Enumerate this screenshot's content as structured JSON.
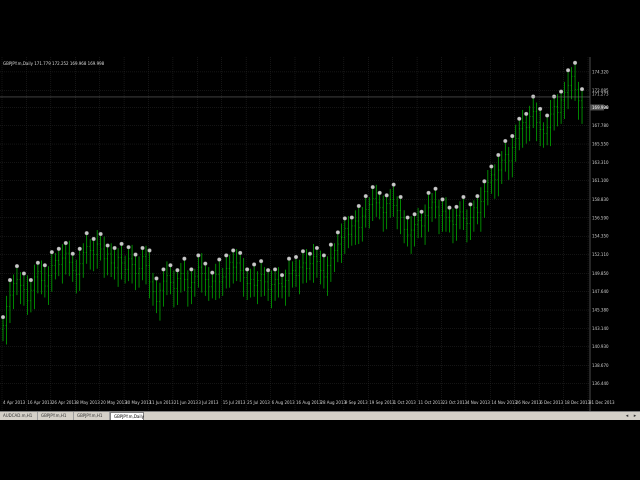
{
  "window": {
    "title": "GBPJPY.m,Daily 171.779 172.252 169.968 169.998",
    "background": "#000000",
    "grid_color": "#2a2a2a",
    "up_bar_color": "#00c000",
    "down_bar_color": "#00c000",
    "marker_color": "#c8c8c8",
    "label_color": "#d0d0d0",
    "price_line_color": "#808080"
  },
  "tabs": [
    {
      "label": "AUDCAD.m,H1",
      "active": false
    },
    {
      "label": "GBPJPY.m,H1",
      "active": false
    },
    {
      "label": "GBPJPY.m,H1",
      "active": false
    },
    {
      "label": "GBPJPY.m,Daily",
      "active": true
    }
  ],
  "tab_nav": {
    "left_icon": "arrow-left-icon",
    "right_icon": "arrow-right-icon"
  },
  "chart_data": {
    "type": "bar",
    "symbol": "GBPJPY.m",
    "timeframe": "Daily",
    "ohlc_header": {
      "open": 171.779,
      "high": 172.252,
      "low": 169.968,
      "close": 169.998
    },
    "current_price_label": "169.998",
    "prev_price_label": "171.273",
    "y_axis_ticks": [
      "174.320",
      "172.085",
      "170.020",
      "167.780",
      "165.550",
      "163.310",
      "161.100",
      "158.830",
      "156.590",
      "154.350",
      "152.110",
      "149.850",
      "147.640",
      "145.380",
      "143.140",
      "140.930",
      "138.670",
      "136.440"
    ],
    "x_axis_ticks": [
      "4 Apr 2013",
      "16 Apr 2013",
      "26 Apr 2013",
      "8 May 2013",
      "20 May 2013",
      "30 May 2013",
      "11 Jun 2013",
      "21 Jun 2013",
      "3 Jul 2013",
      "15 Jul 2013",
      "25 Jul 2013",
      "6 Aug 2013",
      "16 Aug 2013",
      "28 Aug 2013",
      "9 Sep 2013",
      "19 Sep 2013",
      "1 Oct 2013",
      "11 Oct 2013",
      "23 Oct 2013",
      "4 Nov 2013",
      "14 Nov 2013",
      "26 Nov 2013",
      "6 Dec 2013",
      "18 Dec 2013",
      "31 Dec 2013"
    ],
    "ylim": [
      133.6,
      175.4
    ],
    "closes": [
      143.5,
      145.8,
      147.2,
      148.6,
      149.1,
      148.4,
      147.9,
      146.5,
      147.8,
      149.4,
      150.1,
      149.0,
      148.3,
      149.6,
      150.8,
      151.4,
      150.9,
      151.7,
      152.3,
      151.2,
      150.2,
      149.7,
      151.0,
      152.4,
      153.1,
      152.6,
      152.1,
      153.4,
      152.8,
      151.6,
      152.2,
      151.1,
      150.5,
      151.8,
      151.1,
      150.3,
      151.6,
      150.9,
      149.8,
      150.4,
      151.9,
      150.8,
      148.8,
      147.6,
      146.4,
      147.8,
      148.9,
      149.6,
      148.7,
      148.0,
      149.2,
      149.8,
      149.1,
      148.1,
      148.7,
      149.5,
      150.6,
      149.8,
      149.1,
      148.2,
      148.9,
      149.7,
      148.8,
      149.4,
      150.4,
      151.2,
      150.6,
      151.1,
      150.2,
      149.3,
      148.6,
      149.1,
      148.4,
      149.0,
      149.7,
      148.8,
      147.9,
      148.5,
      149.1,
      148.6,
      148.2,
      149.0,
      149.8,
      150.2,
      149.6,
      150.6,
      151.1,
      150.4,
      151.0,
      151.9,
      151.3,
      150.2,
      149.4,
      150.8,
      151.7,
      152.6,
      153.4,
      154.2,
      155.3,
      154.6,
      155.6,
      156.2,
      155.4,
      156.8,
      157.6,
      158.2,
      158.9,
      158.4,
      157.8,
      157.2,
      158.3,
      158.8,
      158.1,
      157.5,
      156.6,
      155.2,
      154.5,
      155.1,
      155.8,
      156.3,
      155.6,
      156.9,
      157.8,
      158.5,
      157.9,
      156.9,
      157.4,
      156.6,
      156.2,
      155.8,
      156.9,
      157.3,
      156.5,
      155.9,
      156.6,
      157.8,
      157.2,
      158.6,
      159.8,
      160.9,
      161.8,
      161.2,
      162.4,
      163.6,
      164.3,
      163.5,
      165.1,
      166.2,
      167.4,
      168.2,
      167.6,
      168.9,
      169.5,
      168.2,
      167.3,
      166.8,
      167.6,
      169.2,
      170.1,
      169.4,
      170.9,
      171.8,
      172.7,
      173.8,
      172.2,
      170.8,
      169.998
    ]
  }
}
